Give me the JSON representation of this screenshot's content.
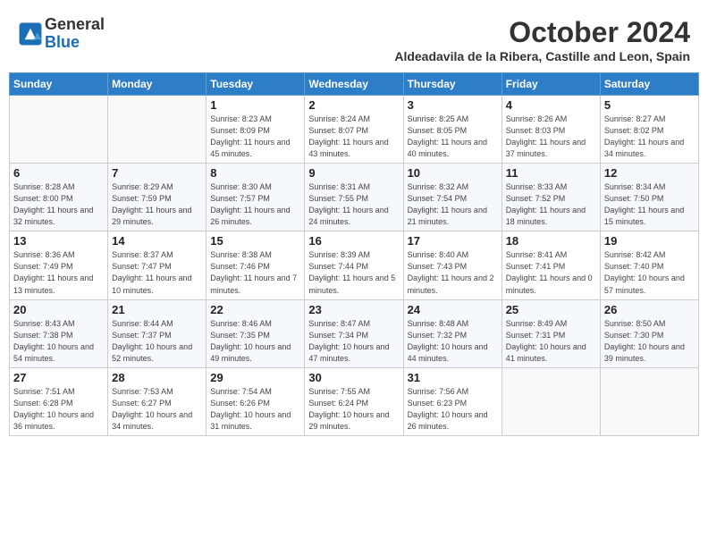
{
  "logo": {
    "general": "General",
    "blue": "Blue"
  },
  "title": "October 2024",
  "subtitle": "Aldeadavila de la Ribera, Castille and Leon, Spain",
  "days_of_week": [
    "Sunday",
    "Monday",
    "Tuesday",
    "Wednesday",
    "Thursday",
    "Friday",
    "Saturday"
  ],
  "weeks": [
    [
      {
        "day": null
      },
      {
        "day": null
      },
      {
        "day": "1",
        "info": "Sunrise: 8:23 AM\nSunset: 8:09 PM\nDaylight: 11 hours and 45 minutes."
      },
      {
        "day": "2",
        "info": "Sunrise: 8:24 AM\nSunset: 8:07 PM\nDaylight: 11 hours and 43 minutes."
      },
      {
        "day": "3",
        "info": "Sunrise: 8:25 AM\nSunset: 8:05 PM\nDaylight: 11 hours and 40 minutes."
      },
      {
        "day": "4",
        "info": "Sunrise: 8:26 AM\nSunset: 8:03 PM\nDaylight: 11 hours and 37 minutes."
      },
      {
        "day": "5",
        "info": "Sunrise: 8:27 AM\nSunset: 8:02 PM\nDaylight: 11 hours and 34 minutes."
      }
    ],
    [
      {
        "day": "6",
        "info": "Sunrise: 8:28 AM\nSunset: 8:00 PM\nDaylight: 11 hours and 32 minutes."
      },
      {
        "day": "7",
        "info": "Sunrise: 8:29 AM\nSunset: 7:59 PM\nDaylight: 11 hours and 29 minutes."
      },
      {
        "day": "8",
        "info": "Sunrise: 8:30 AM\nSunset: 7:57 PM\nDaylight: 11 hours and 26 minutes."
      },
      {
        "day": "9",
        "info": "Sunrise: 8:31 AM\nSunset: 7:55 PM\nDaylight: 11 hours and 24 minutes."
      },
      {
        "day": "10",
        "info": "Sunrise: 8:32 AM\nSunset: 7:54 PM\nDaylight: 11 hours and 21 minutes."
      },
      {
        "day": "11",
        "info": "Sunrise: 8:33 AM\nSunset: 7:52 PM\nDaylight: 11 hours and 18 minutes."
      },
      {
        "day": "12",
        "info": "Sunrise: 8:34 AM\nSunset: 7:50 PM\nDaylight: 11 hours and 15 minutes."
      }
    ],
    [
      {
        "day": "13",
        "info": "Sunrise: 8:36 AM\nSunset: 7:49 PM\nDaylight: 11 hours and 13 minutes."
      },
      {
        "day": "14",
        "info": "Sunrise: 8:37 AM\nSunset: 7:47 PM\nDaylight: 11 hours and 10 minutes."
      },
      {
        "day": "15",
        "info": "Sunrise: 8:38 AM\nSunset: 7:46 PM\nDaylight: 11 hours and 7 minutes."
      },
      {
        "day": "16",
        "info": "Sunrise: 8:39 AM\nSunset: 7:44 PM\nDaylight: 11 hours and 5 minutes."
      },
      {
        "day": "17",
        "info": "Sunrise: 8:40 AM\nSunset: 7:43 PM\nDaylight: 11 hours and 2 minutes."
      },
      {
        "day": "18",
        "info": "Sunrise: 8:41 AM\nSunset: 7:41 PM\nDaylight: 11 hours and 0 minutes."
      },
      {
        "day": "19",
        "info": "Sunrise: 8:42 AM\nSunset: 7:40 PM\nDaylight: 10 hours and 57 minutes."
      }
    ],
    [
      {
        "day": "20",
        "info": "Sunrise: 8:43 AM\nSunset: 7:38 PM\nDaylight: 10 hours and 54 minutes."
      },
      {
        "day": "21",
        "info": "Sunrise: 8:44 AM\nSunset: 7:37 PM\nDaylight: 10 hours and 52 minutes."
      },
      {
        "day": "22",
        "info": "Sunrise: 8:46 AM\nSunset: 7:35 PM\nDaylight: 10 hours and 49 minutes."
      },
      {
        "day": "23",
        "info": "Sunrise: 8:47 AM\nSunset: 7:34 PM\nDaylight: 10 hours and 47 minutes."
      },
      {
        "day": "24",
        "info": "Sunrise: 8:48 AM\nSunset: 7:32 PM\nDaylight: 10 hours and 44 minutes."
      },
      {
        "day": "25",
        "info": "Sunrise: 8:49 AM\nSunset: 7:31 PM\nDaylight: 10 hours and 41 minutes."
      },
      {
        "day": "26",
        "info": "Sunrise: 8:50 AM\nSunset: 7:30 PM\nDaylight: 10 hours and 39 minutes."
      }
    ],
    [
      {
        "day": "27",
        "info": "Sunrise: 7:51 AM\nSunset: 6:28 PM\nDaylight: 10 hours and 36 minutes."
      },
      {
        "day": "28",
        "info": "Sunrise: 7:53 AM\nSunset: 6:27 PM\nDaylight: 10 hours and 34 minutes."
      },
      {
        "day": "29",
        "info": "Sunrise: 7:54 AM\nSunset: 6:26 PM\nDaylight: 10 hours and 31 minutes."
      },
      {
        "day": "30",
        "info": "Sunrise: 7:55 AM\nSunset: 6:24 PM\nDaylight: 10 hours and 29 minutes."
      },
      {
        "day": "31",
        "info": "Sunrise: 7:56 AM\nSunset: 6:23 PM\nDaylight: 10 hours and 26 minutes."
      },
      {
        "day": null
      },
      {
        "day": null
      }
    ]
  ]
}
